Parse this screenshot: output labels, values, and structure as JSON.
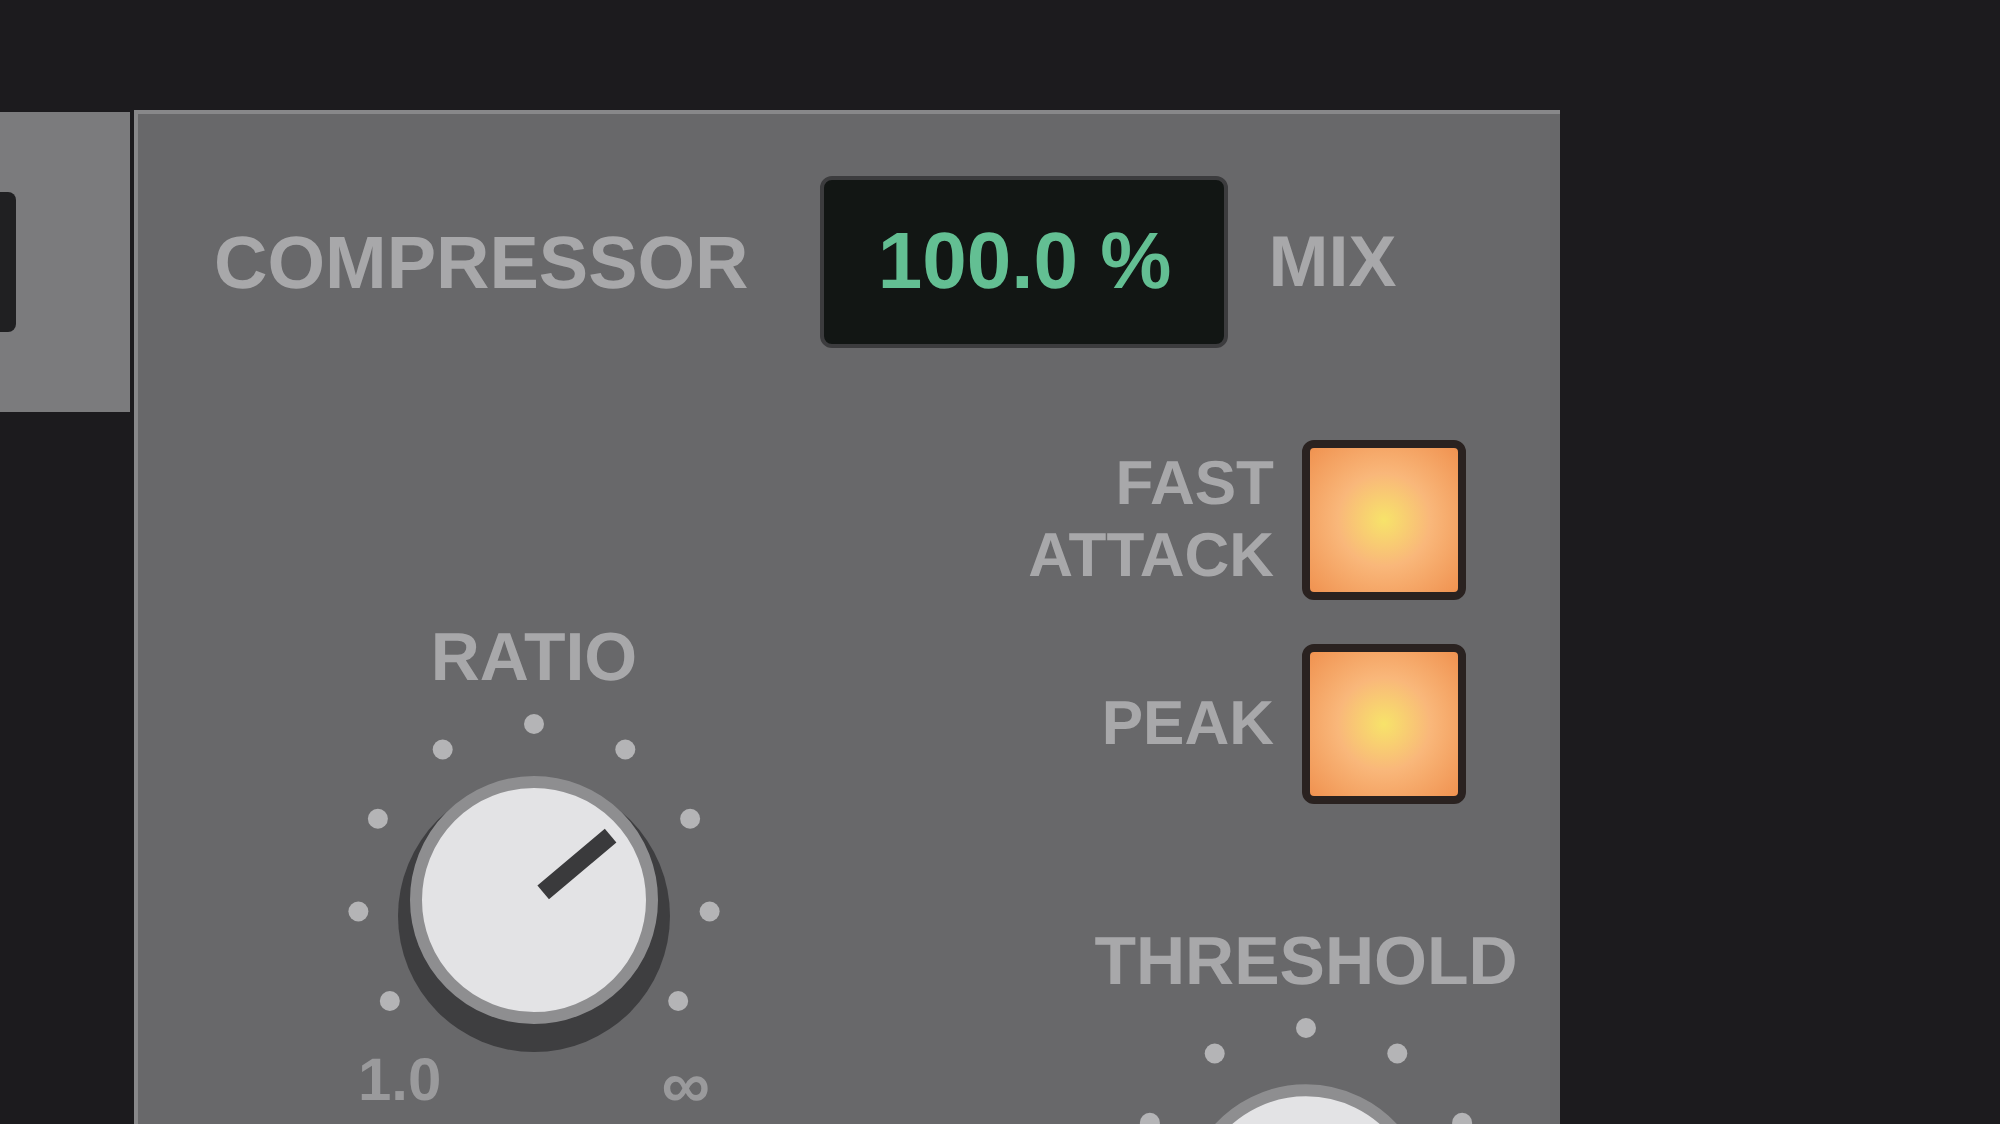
{
  "header": {
    "title": "COMPRESSOR",
    "mix_display": "100.0 %",
    "mix_label": "MIX"
  },
  "switches": [
    {
      "lines": [
        "FAST",
        "ATTACK"
      ],
      "on": true
    },
    {
      "lines": [
        "PEAK"
      ],
      "on": true
    }
  ],
  "ratio": {
    "label": "RATIO",
    "level": 0.7,
    "min_label": "1.0",
    "max_label": "∞"
  },
  "threshold": {
    "label": "THRESHOLD"
  }
}
